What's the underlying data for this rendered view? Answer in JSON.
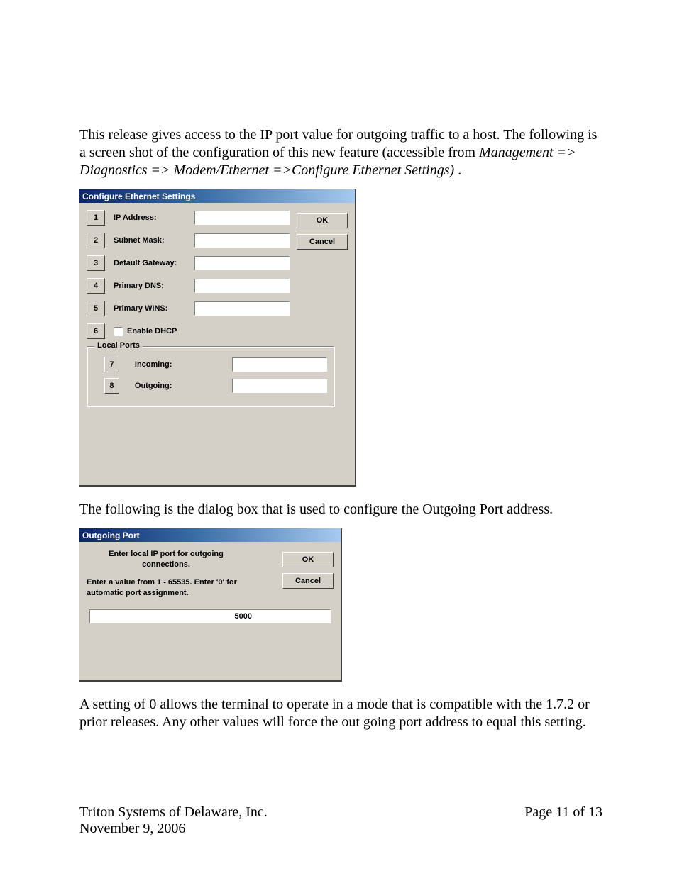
{
  "intro": {
    "p1_a": "This release gives access to the IP port value for outgoing traffic to a host.  The following is a screen shot of the configuration of this new feature (accessible from ",
    "p1_path": "Management => Diagnostics => Modem/Ethernet =>Configure Ethernet Settings)",
    "p1_b": "."
  },
  "dialog1": {
    "title": "Configure Ethernet Settings",
    "rows": [
      {
        "num": "1",
        "label": "IP Address:",
        "value": ""
      },
      {
        "num": "2",
        "label": "Subnet Mask:",
        "value": ""
      },
      {
        "num": "3",
        "label": "Default Gateway:",
        "value": ""
      },
      {
        "num": "4",
        "label": "Primary DNS:",
        "value": ""
      },
      {
        "num": "5",
        "label": "Primary WINS:",
        "value": ""
      }
    ],
    "dhcp": {
      "num": "6",
      "label": "Enable DHCP",
      "checked": false
    },
    "group_label": "Local Ports",
    "ports": {
      "incoming": {
        "num": "7",
        "label": "Incoming:",
        "value": ""
      },
      "outgoing": {
        "num": "8",
        "label": "Outgoing:",
        "value": ""
      }
    },
    "ok": "OK",
    "cancel": "Cancel"
  },
  "mid_para": "The following is the dialog box that is used to configure the Outgoing Port address.",
  "dialog2": {
    "title": "Outgoing Port",
    "line1": "Enter local IP port for outgoing connections.",
    "line2": "Enter a value from 1 - 65535. Enter '0' for automatic port assignment.",
    "value": "5000",
    "ok": "OK",
    "cancel": "Cancel"
  },
  "closing": "A setting of 0 allows the terminal to operate in a mode that is compatible with the 1.7.2 or prior releases.  Any other values will force the out going port address to equal this setting.",
  "footer": {
    "company": "Triton Systems of Delaware, Inc.",
    "page": "Page 11 of 13",
    "date": "November 9, 2006"
  }
}
